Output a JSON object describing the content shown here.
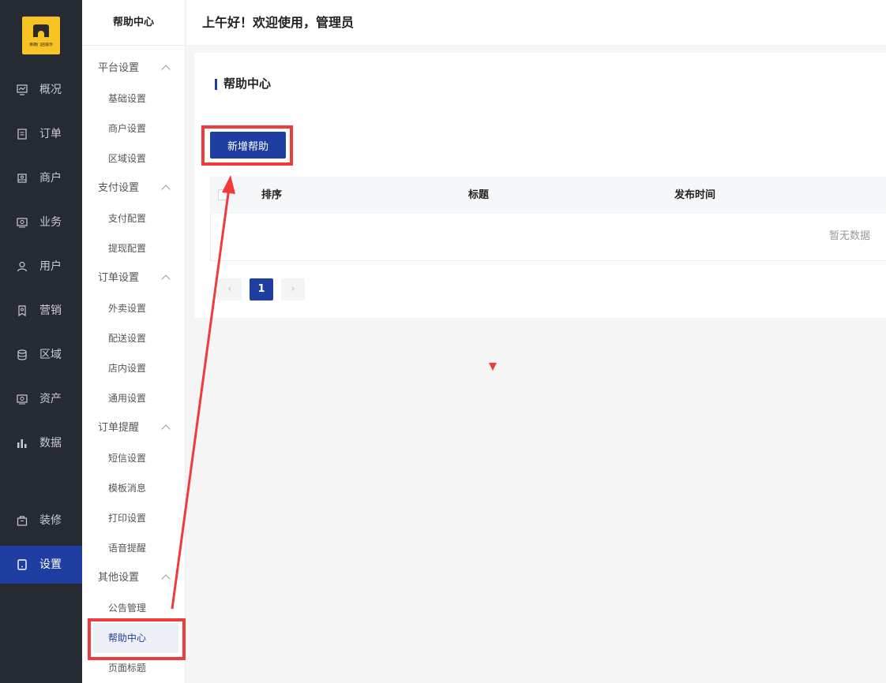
{
  "nav": {
    "logo_text": "果蔬门店展示",
    "items": [
      {
        "label": "概况",
        "icon": "chart-board-icon"
      },
      {
        "label": "订单",
        "icon": "document-icon"
      },
      {
        "label": "商户",
        "icon": "store-icon"
      },
      {
        "label": "业务",
        "icon": "briefcase-icon"
      },
      {
        "label": "用户",
        "icon": "user-icon"
      },
      {
        "label": "营销",
        "icon": "tag-icon"
      },
      {
        "label": "区域",
        "icon": "database-icon"
      },
      {
        "label": "资产",
        "icon": "wallet-icon"
      },
      {
        "label": "数据",
        "icon": "bar-chart-icon"
      },
      {
        "label": "装修",
        "icon": "bag-icon"
      },
      {
        "label": "设置",
        "icon": "tablet-icon"
      }
    ],
    "active": "设置"
  },
  "subnav": {
    "title": "帮助中心",
    "groups": [
      {
        "label": "平台设置",
        "items": [
          "基础设置",
          "商户设置",
          "区域设置"
        ]
      },
      {
        "label": "支付设置",
        "items": [
          "支付配置",
          "提现配置"
        ]
      },
      {
        "label": "订单设置",
        "items": [
          "外卖设置",
          "配送设置",
          "店内设置",
          "通用设置"
        ]
      },
      {
        "label": "订单提醒",
        "items": [
          "短信设置",
          "模板消息",
          "打印设置",
          "语音提醒"
        ]
      },
      {
        "label": "其他设置",
        "items": [
          "公告管理",
          "帮助中心",
          "页面标题"
        ]
      }
    ],
    "active": "帮助中心"
  },
  "header": {
    "greeting": "上午好！欢迎使用，管理员"
  },
  "main": {
    "title": "帮助中心",
    "add_button": "新增帮助",
    "columns": [
      "排序",
      "标题",
      "发布时间"
    ],
    "empty_text": "暂无数据",
    "pagination": {
      "prev": "‹",
      "current": "1",
      "next": "›"
    }
  },
  "colors": {
    "primary": "#1e3ea1",
    "sidebar": "#262a33",
    "annotation": "#ee3b3b"
  }
}
